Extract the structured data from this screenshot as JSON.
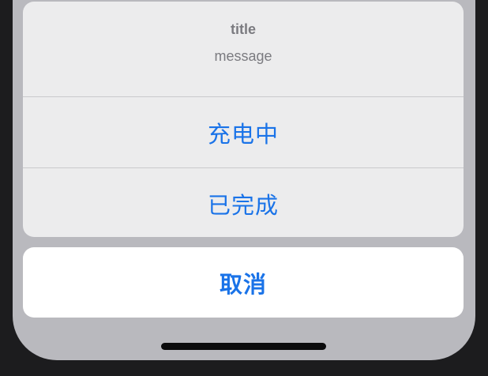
{
  "sheet": {
    "title": "title",
    "message": "message",
    "actions": [
      {
        "label": "充电中"
      },
      {
        "label": "已完成"
      }
    ],
    "cancel_label": "取消"
  },
  "colors": {
    "accent": "#1a73e8",
    "sheet_background": "#ececed",
    "dim_background": "#b9b9be",
    "secondary_text": "#7b7b80"
  }
}
